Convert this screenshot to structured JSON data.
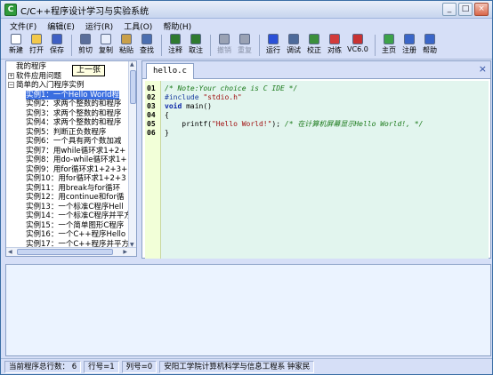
{
  "window": {
    "title": "C/C++程序设计学习与实验系统",
    "controls": {
      "minimize": "_",
      "maximize": "□",
      "close": "×"
    }
  },
  "menu": [
    {
      "label": "文件(F)"
    },
    {
      "label": "编辑(E)"
    },
    {
      "label": "运行(R)"
    },
    {
      "label": "工具(O)"
    },
    {
      "label": "帮助(H)"
    }
  ],
  "toolbar": {
    "buttons": [
      {
        "label": "新建",
        "icon": "new-file-icon",
        "color": "#ffffff",
        "disabled": false
      },
      {
        "label": "打开",
        "icon": "open-folder-icon",
        "color": "#f2c84b",
        "disabled": false
      },
      {
        "label": "保存",
        "icon": "save-disk-icon",
        "color": "#3e5fc4",
        "disabled": false
      },
      {
        "label": "剪切",
        "icon": "cut-icon",
        "color": "#5a6e9a",
        "disabled": false
      },
      {
        "label": "复制",
        "icon": "copy-icon",
        "color": "#e8eefb",
        "disabled": false
      },
      {
        "label": "粘贴",
        "icon": "paste-icon",
        "color": "#c9a04a",
        "disabled": false
      },
      {
        "label": "查找",
        "icon": "find-icon",
        "color": "#4a6eb0",
        "disabled": false
      },
      {
        "label": "注释",
        "icon": "comment-icon",
        "color": "#2f7a2f",
        "disabled": false
      },
      {
        "label": "取注",
        "icon": "uncomment-icon",
        "color": "#2f7a2f",
        "disabled": false
      },
      {
        "label": "撤销",
        "icon": "undo-icon",
        "color": "#9aa2b4",
        "disabled": true
      },
      {
        "label": "重复",
        "icon": "redo-icon",
        "color": "#9aa2b4",
        "disabled": true
      },
      {
        "label": "运行",
        "icon": "run-icon",
        "color": "#2a50d8",
        "disabled": false
      },
      {
        "label": "调试",
        "icon": "debug-icon",
        "color": "#4d6a9a",
        "disabled": false
      },
      {
        "label": "校正",
        "icon": "check-icon",
        "color": "#3b8f3b",
        "disabled": false
      },
      {
        "label": "对练",
        "icon": "practice-icon",
        "color": "#d23b3b",
        "disabled": false
      },
      {
        "label": "VC6.0",
        "icon": "vc6-icon",
        "color": "#c83232",
        "disabled": false
      },
      {
        "label": "主页",
        "icon": "home-icon",
        "color": "#3da24a",
        "disabled": false
      },
      {
        "label": "注册",
        "icon": "register-icon",
        "color": "#3a66c8",
        "disabled": false
      },
      {
        "label": "帮助",
        "icon": "help-icon",
        "color": "#3a66c8",
        "disabled": false
      }
    ]
  },
  "tree": {
    "tooltip": "上一张",
    "items": [
      {
        "text": "我的程序",
        "level": 0,
        "expander": ""
      },
      {
        "text": "软件应用问题",
        "level": 0,
        "expander": "+"
      },
      {
        "text": "简单的入门程序实例",
        "level": 0,
        "expander": "−"
      },
      {
        "text": "实例1：一个Hello World程",
        "level": 1,
        "selected": true
      },
      {
        "text": "实例2：求两个整数的和程序",
        "level": 1
      },
      {
        "text": "实例3：求两个整数的和程序",
        "level": 1
      },
      {
        "text": "实例4：求两个整数的和程序",
        "level": 1
      },
      {
        "text": "实例5：判断正负数程序",
        "level": 1
      },
      {
        "text": "实例6：一个具有两个数加减",
        "level": 1
      },
      {
        "text": "实例7：用while循环求1+2+",
        "level": 1
      },
      {
        "text": "实例8：用do-while循环求1+",
        "level": 1
      },
      {
        "text": "实例9：用for循环求1+2+3+",
        "level": 1
      },
      {
        "text": "实例10：用for循环求1+2+3",
        "level": 1
      },
      {
        "text": "实例11：用break与for循环",
        "level": 1
      },
      {
        "text": "实例12：用continue和for循",
        "level": 1
      },
      {
        "text": "实例13：一个标准C程序Hell",
        "level": 1
      },
      {
        "text": "实例14：一个标准C程序并平方",
        "level": 1
      },
      {
        "text": "实例15：一个简单图形C程序",
        "level": 1
      },
      {
        "text": "实例16：一个C++程序Hello",
        "level": 1
      },
      {
        "text": "实例17：一个C++程序并平方",
        "level": 1
      }
    ]
  },
  "editor": {
    "tab_label": "hello.c",
    "close_glyph": "×",
    "lines": [
      {
        "no": "01",
        "parts": [
          {
            "cls": "c-comment",
            "text": "/* Note:Your choice is C IDE */"
          }
        ]
      },
      {
        "no": "02",
        "parts": [
          {
            "cls": "c-pp",
            "text": "#include "
          },
          {
            "cls": "c-str",
            "text": "\"stdio.h\""
          }
        ]
      },
      {
        "no": "03",
        "parts": [
          {
            "cls": "c-kw",
            "text": "void "
          },
          {
            "cls": "c-plain",
            "text": "main()"
          }
        ]
      },
      {
        "no": "04",
        "parts": [
          {
            "cls": "c-plain",
            "text": "{"
          }
        ]
      },
      {
        "no": "05",
        "parts": [
          {
            "cls": "c-plain",
            "text": "    printf("
          },
          {
            "cls": "c-str",
            "text": "\"Hello World!\""
          },
          {
            "cls": "c-plain",
            "text": "); "
          },
          {
            "cls": "c-comment",
            "text": "/* 在计算机屏幕显示Hello World!, */"
          }
        ]
      },
      {
        "no": "06",
        "parts": [
          {
            "cls": "c-plain",
            "text": "}"
          }
        ]
      }
    ]
  },
  "statusbar": {
    "total_lines_label": "当前程序总行数：",
    "total_lines": "6",
    "row": "行号=1",
    "col": "列号=0",
    "credit": "安阳工学院计算机科学与信息工程系   钟家民"
  }
}
